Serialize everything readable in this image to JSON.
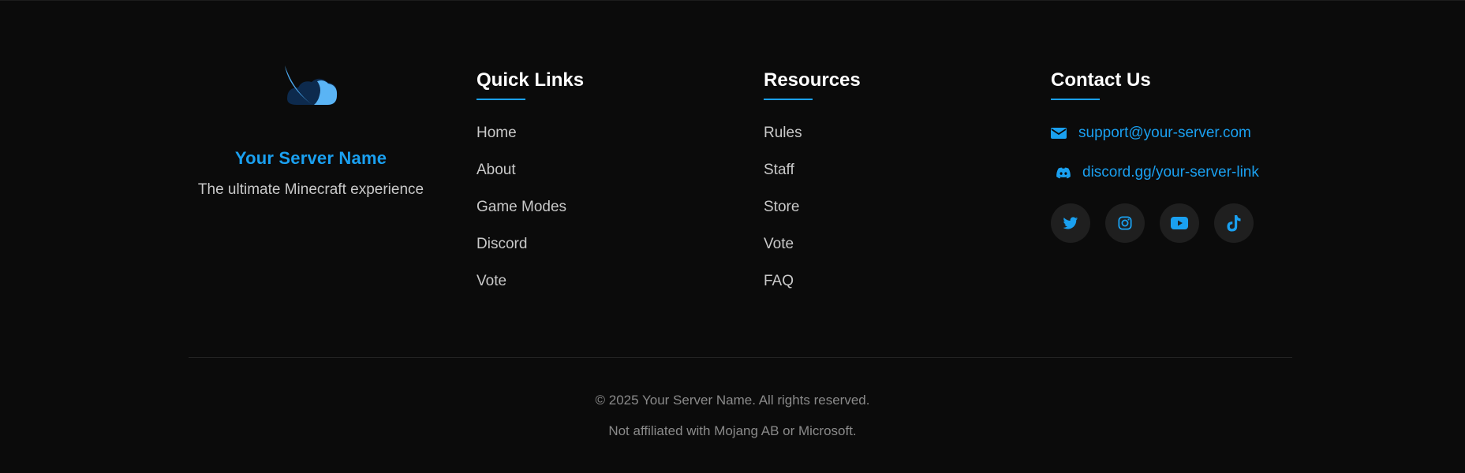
{
  "brand": {
    "name": "Your Server Name",
    "tagline": "The ultimate Minecraft experience",
    "logo_icon": "cloud-logo-icon"
  },
  "quick_links": {
    "title": "Quick Links",
    "items": [
      "Home",
      "About",
      "Game Modes",
      "Discord",
      "Vote"
    ]
  },
  "resources": {
    "title": "Resources",
    "items": [
      "Rules",
      "Staff",
      "Store",
      "Vote",
      "FAQ"
    ]
  },
  "contact": {
    "title": "Contact Us",
    "email": "support@your-server.com",
    "discord": "discord.gg/your-server-link",
    "socials": [
      "twitter-icon",
      "instagram-icon",
      "youtube-icon",
      "tiktok-icon"
    ]
  },
  "bottom": {
    "copyright": "© 2025 Your Server Name. All rights reserved.",
    "disclaimer": "Not affiliated with Mojang AB or Microsoft."
  },
  "colors": {
    "background": "#0b0b0b",
    "accent": "#1aa0f0",
    "heading": "#ffffff",
    "link": "#c9c9c9",
    "muted": "#8a8a8a",
    "social_bg": "#1f1f1f"
  }
}
